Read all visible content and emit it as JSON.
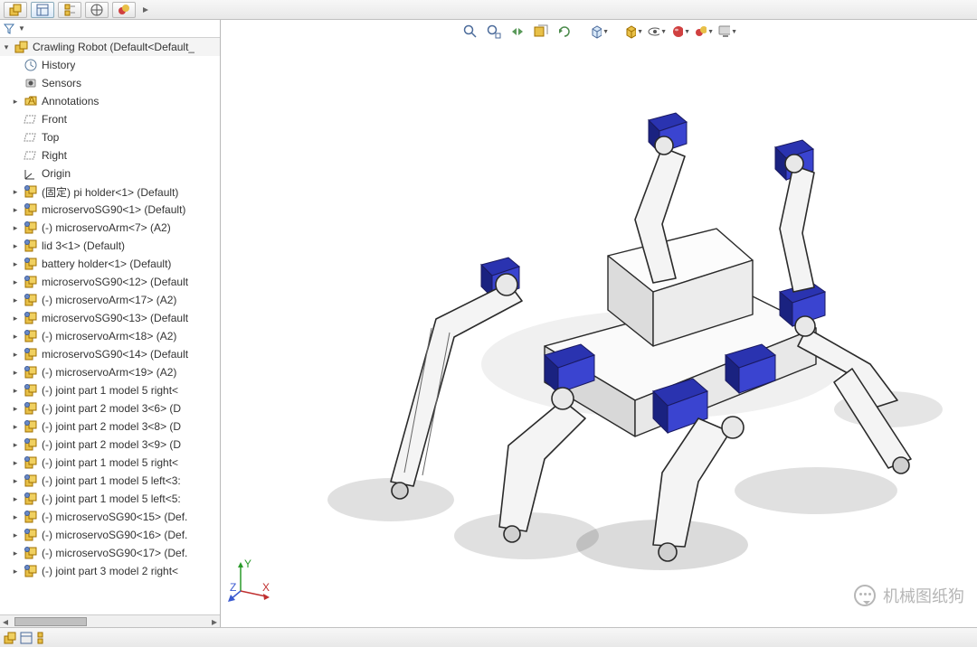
{
  "topTabs": [
    {
      "name": "assembly",
      "glyph": "cube",
      "active": false
    },
    {
      "name": "feature-tree",
      "glyph": "panel",
      "active": true
    },
    {
      "name": "property-mgr",
      "glyph": "pm",
      "active": false
    },
    {
      "name": "configuration",
      "glyph": "target",
      "active": false
    },
    {
      "name": "display-mgr",
      "glyph": "circles",
      "active": false
    },
    {
      "name": "expand",
      "glyph": "chev",
      "active": false
    }
  ],
  "filter": {
    "placeholder": ""
  },
  "tree": {
    "root": {
      "label": "Crawling Robot  (Default<Default_",
      "icon": "asm"
    },
    "items": [
      {
        "label": "History",
        "icon": "history",
        "expander": false,
        "indent": 1
      },
      {
        "label": "Sensors",
        "icon": "sensor",
        "expander": false,
        "indent": 1
      },
      {
        "label": "Annotations",
        "icon": "folder",
        "expander": true,
        "indent": 1
      },
      {
        "label": "Front",
        "icon": "plane",
        "expander": false,
        "indent": 1
      },
      {
        "label": "Top",
        "icon": "plane",
        "expander": false,
        "indent": 1
      },
      {
        "label": "Right",
        "icon": "plane",
        "expander": false,
        "indent": 1
      },
      {
        "label": "Origin",
        "icon": "origin",
        "expander": false,
        "indent": 1
      },
      {
        "label": "(固定) pi holder<1> (Default)",
        "icon": "part",
        "expander": true,
        "indent": 1
      },
      {
        "label": "microservoSG90<1> (Default)",
        "icon": "part",
        "expander": true,
        "indent": 1
      },
      {
        "label": "(-) microservoArm<7> (A2)",
        "icon": "part",
        "expander": true,
        "indent": 1
      },
      {
        "label": "lid 3<1> (Default)",
        "icon": "part",
        "expander": true,
        "indent": 1
      },
      {
        "label": "battery holder<1> (Default)",
        "icon": "part",
        "expander": true,
        "indent": 1
      },
      {
        "label": "microservoSG90<12> (Default",
        "icon": "part",
        "expander": true,
        "indent": 1
      },
      {
        "label": "(-) microservoArm<17> (A2)",
        "icon": "part",
        "expander": true,
        "indent": 1
      },
      {
        "label": "microservoSG90<13> (Default",
        "icon": "part",
        "expander": true,
        "indent": 1
      },
      {
        "label": "(-) microservoArm<18> (A2)",
        "icon": "part",
        "expander": true,
        "indent": 1
      },
      {
        "label": "microservoSG90<14> (Default",
        "icon": "part",
        "expander": true,
        "indent": 1
      },
      {
        "label": "(-) microservoArm<19> (A2)",
        "icon": "part",
        "expander": true,
        "indent": 1
      },
      {
        "label": "(-) joint part 1 model 5 right<",
        "icon": "part",
        "expander": true,
        "indent": 1
      },
      {
        "label": "(-) joint part 2 model 3<6> (D",
        "icon": "part",
        "expander": true,
        "indent": 1
      },
      {
        "label": "(-) joint part 2 model 3<8> (D",
        "icon": "part",
        "expander": true,
        "indent": 1
      },
      {
        "label": "(-) joint part 2 model 3<9> (D",
        "icon": "part",
        "expander": true,
        "indent": 1
      },
      {
        "label": "(-) joint part 1 model 5 right<",
        "icon": "part",
        "expander": true,
        "indent": 1
      },
      {
        "label": "(-) joint part 1 model 5 left<3:",
        "icon": "part",
        "expander": true,
        "indent": 1
      },
      {
        "label": "(-) joint part 1 model 5 left<5:",
        "icon": "part",
        "expander": true,
        "indent": 1
      },
      {
        "label": "(-) microservoSG90<15> (Def.",
        "icon": "part",
        "expander": true,
        "indent": 1
      },
      {
        "label": "(-) microservoSG90<16> (Def.",
        "icon": "part",
        "expander": true,
        "indent": 1
      },
      {
        "label": "(-) microservoSG90<17> (Def.",
        "icon": "part",
        "expander": true,
        "indent": 1
      },
      {
        "label": "(-) joint part 3 model 2 right<",
        "icon": "part",
        "expander": true,
        "indent": 1
      }
    ]
  },
  "bottomTabs": [
    {
      "name": "model",
      "glyph": "cube"
    },
    {
      "name": "motion",
      "glyph": "panel"
    },
    {
      "name": "anim",
      "glyph": "pm"
    }
  ],
  "hud": [
    {
      "name": "zoom-fit",
      "glyph": "magnify"
    },
    {
      "name": "zoom-area",
      "glyph": "magnify2"
    },
    {
      "name": "prev-view",
      "glyph": "arrows"
    },
    {
      "name": "section",
      "glyph": "section"
    },
    {
      "name": "dyn",
      "glyph": "refresh"
    },
    {
      "name": "view-orient",
      "glyph": "cubeview",
      "drop": true
    },
    {
      "name": "display-style",
      "glyph": "cube2",
      "drop": true
    },
    {
      "name": "hide-show",
      "glyph": "eye",
      "drop": true
    },
    {
      "name": "edit-appearance",
      "glyph": "sphere",
      "drop": true
    },
    {
      "name": "scene",
      "glyph": "scene",
      "drop": true
    },
    {
      "name": "render",
      "glyph": "monitor",
      "drop": true
    }
  ],
  "triad": {
    "x": "X",
    "y": "Y",
    "z": "Z"
  },
  "watermark": {
    "text": "机械图纸狗"
  }
}
